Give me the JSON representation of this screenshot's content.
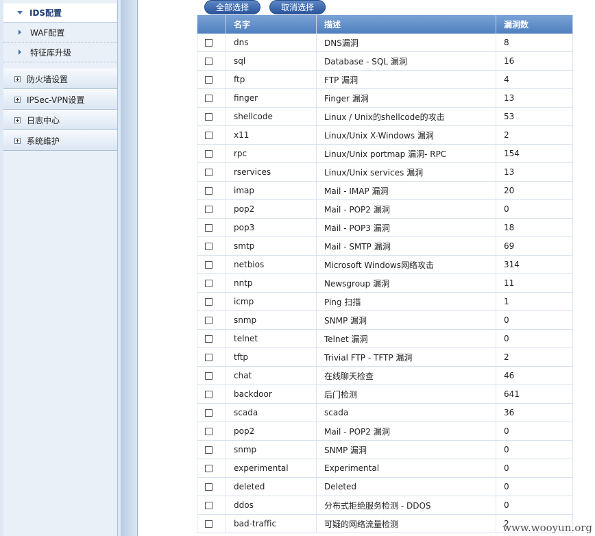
{
  "sidebar": {
    "active_item": "IDS配置",
    "sub_items": [
      "WAF配置",
      "特征库升级"
    ],
    "groups": [
      "防火墙设置",
      "IPSec-VPN设置",
      "日志中心",
      "系统维护"
    ]
  },
  "toolbar": {
    "select_all_label": "全部选择",
    "deselect_label": "取消选择"
  },
  "table": {
    "headers": [
      "名字",
      "描述",
      "漏洞数"
    ],
    "rows": [
      {
        "name": "dns",
        "desc": "DNS漏洞",
        "count": "8"
      },
      {
        "name": "sql",
        "desc": "Database - SQL 漏洞",
        "count": "16"
      },
      {
        "name": "ftp",
        "desc": "FTP 漏洞",
        "count": "4"
      },
      {
        "name": "finger",
        "desc": "Finger 漏洞",
        "count": "13"
      },
      {
        "name": "shellcode",
        "desc": "Linux / Unix的shellcode的攻击",
        "count": "53"
      },
      {
        "name": "x11",
        "desc": "Linux/Unix X-Windows 漏洞",
        "count": "2"
      },
      {
        "name": "rpc",
        "desc": "Linux/Unix portmap 漏洞- RPC",
        "count": "154"
      },
      {
        "name": "rservices",
        "desc": "Linux/Unix services 漏洞",
        "count": "13"
      },
      {
        "name": "imap",
        "desc": "Mail - IMAP 漏洞",
        "count": "20"
      },
      {
        "name": "pop2",
        "desc": "Mail - POP2 漏洞",
        "count": "0"
      },
      {
        "name": "pop3",
        "desc": "Mail - POP3 漏洞",
        "count": "18"
      },
      {
        "name": "smtp",
        "desc": "Mail - SMTP 漏洞",
        "count": "69"
      },
      {
        "name": "netbios",
        "desc": "Microsoft Windows网络攻击",
        "count": "314"
      },
      {
        "name": "nntp",
        "desc": "Newsgroup 漏洞",
        "count": "11"
      },
      {
        "name": "icmp",
        "desc": "Ping 扫描",
        "count": "1"
      },
      {
        "name": "snmp",
        "desc": "SNMP 漏洞",
        "count": "0"
      },
      {
        "name": "telnet",
        "desc": "Telnet 漏洞",
        "count": "0"
      },
      {
        "name": "tftp",
        "desc": "Trivial FTP - TFTP 漏洞",
        "count": "2"
      },
      {
        "name": "chat",
        "desc": "在线聊天检查",
        "count": "46"
      },
      {
        "name": "backdoor",
        "desc": "后门检测",
        "count": "641"
      },
      {
        "name": "scada",
        "desc": "scada",
        "count": "36"
      },
      {
        "name": "pop2",
        "desc": "Mail - POP2 漏洞",
        "count": "0"
      },
      {
        "name": "snmp",
        "desc": "SNMP 漏洞",
        "count": "0"
      },
      {
        "name": "experimental",
        "desc": "Experimental",
        "count": "0"
      },
      {
        "name": "deleted",
        "desc": "Deleted",
        "count": "0"
      },
      {
        "name": "ddos",
        "desc": "分布式拒绝服务检测 - DDOS",
        "count": "0"
      },
      {
        "name": "bad-traffic",
        "desc": "可疑的网络流量检测",
        "count": "2"
      }
    ]
  },
  "watermark": "www.wooyun.org"
}
